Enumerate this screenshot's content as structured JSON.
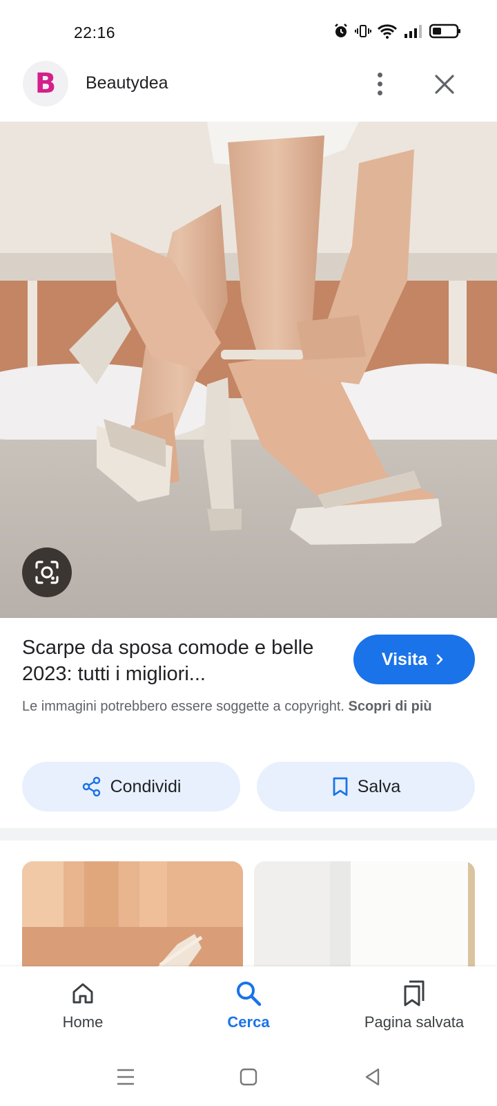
{
  "status_bar": {
    "time": "22:16",
    "icons": [
      "alarm-icon",
      "vibrate-icon",
      "wifi-icon",
      "signal-icon",
      "battery-icon"
    ]
  },
  "header": {
    "logo_letter": "B",
    "site_name": "Beautydea",
    "icons": [
      "more-vert-icon",
      "close-icon"
    ]
  },
  "result": {
    "title": "Scarpe da sposa comode e belle 2023: tutti i migliori...",
    "visit_label": "Visita",
    "copyright_text": "Le immagini potrebbero essere soggette a copyright.",
    "learn_more": "Scopri di più"
  },
  "actions": {
    "share_label": "Condividi",
    "save_label": "Salva"
  },
  "bottom_nav": {
    "items": [
      {
        "label": "Home",
        "icon": "home-icon",
        "active": false
      },
      {
        "label": "Cerca",
        "icon": "search-icon",
        "active": true
      },
      {
        "label": "Pagina salvata",
        "icon": "bookmarks-icon",
        "active": false
      }
    ]
  },
  "colors": {
    "accent": "#1a73e8",
    "brand_logo": "#d4208a",
    "action_button_bg": "#e8f0fe"
  }
}
